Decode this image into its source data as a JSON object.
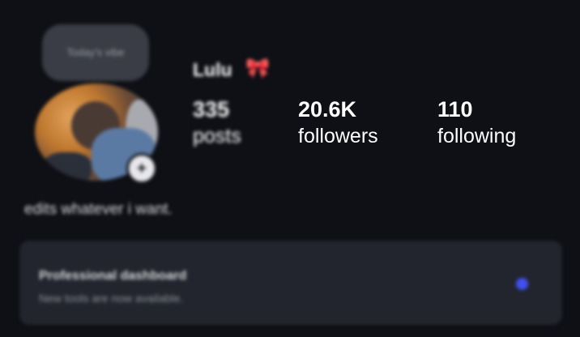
{
  "profile": {
    "note": "Today's vibe",
    "username": "Lulu",
    "username_emoji": "🎀",
    "bio": "edits whatever i want."
  },
  "stats": {
    "posts": {
      "value": "335",
      "label": "posts"
    },
    "followers": {
      "value": "20.6K",
      "label": "followers"
    },
    "following": {
      "value": "110",
      "label": "following"
    }
  },
  "dashboard": {
    "title": "Professional dashboard",
    "subtitle": "New tools are now available."
  },
  "colors": {
    "background": "#0e1015",
    "card": "#22252d",
    "accent_dot": "#4250f2",
    "bow": "#e53935"
  }
}
